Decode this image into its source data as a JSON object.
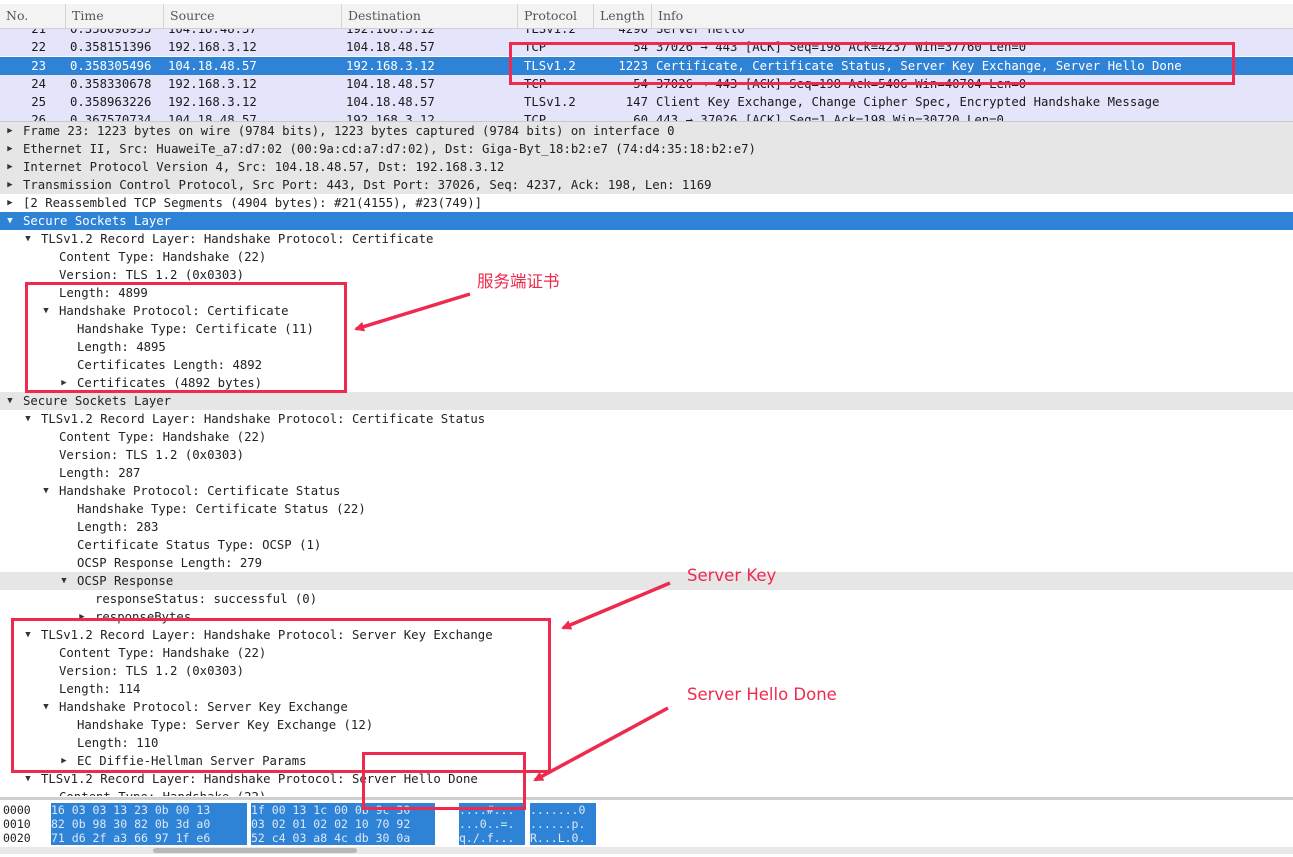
{
  "packet_list": {
    "columns": [
      "No.",
      "Time",
      "Source",
      "Destination",
      "Protocol",
      "Length",
      "Info"
    ],
    "rows": [
      {
        "no": "21",
        "time": "0.358098955",
        "src": "104.18.48.57",
        "dst": "192.168.3.12",
        "proto": "TLSv1.2",
        "len": "4290",
        "info": "Server Hello"
      },
      {
        "no": "22",
        "time": "0.358151396",
        "src": "192.168.3.12",
        "dst": "104.18.48.57",
        "proto": "TCP",
        "len": "54",
        "info": "37026 → 443 [ACK] Seq=198 Ack=4237 Win=37760 Len=0"
      },
      {
        "no": "23",
        "time": "0.358305496",
        "src": "104.18.48.57",
        "dst": "192.168.3.12",
        "proto": "TLSv1.2",
        "len": "1223",
        "info": "Certificate, Certificate Status, Server Key Exchange, Server Hello Done"
      },
      {
        "no": "24",
        "time": "0.358330678",
        "src": "192.168.3.12",
        "dst": "104.18.48.57",
        "proto": "TCP",
        "len": "54",
        "info": "37026 → 443 [ACK] Seq=198 Ack=5406 Win=40704 Len=0"
      },
      {
        "no": "25",
        "time": "0.358963226",
        "src": "192.168.3.12",
        "dst": "104.18.48.57",
        "proto": "TLSv1.2",
        "len": "147",
        "info": "Client Key Exchange, Change Cipher Spec, Encrypted Handshake Message"
      },
      {
        "no": "26",
        "time": "0.367570734",
        "src": "104.18.48.57",
        "dst": "192.168.3.12",
        "proto": "TCP",
        "len": "60",
        "info": "443 → 37026 [ACK] Seq=1 Ack=198 Win=30720 Len=0"
      }
    ]
  },
  "details": [
    {
      "indent": 0,
      "expander": "collapsed",
      "text": "Frame 23: 1223 bytes on wire (9784 bits), 1223 bytes captured (9784 bits) on interface 0",
      "style": "grey"
    },
    {
      "indent": 0,
      "expander": "collapsed",
      "text": "Ethernet II, Src: HuaweiTe_a7:d7:02 (00:9a:cd:a7:d7:02), Dst: Giga-Byt_18:b2:e7 (74:d4:35:18:b2:e7)",
      "style": "grey"
    },
    {
      "indent": 0,
      "expander": "collapsed",
      "text": "Internet Protocol Version 4, Src: 104.18.48.57, Dst: 192.168.3.12",
      "style": "grey"
    },
    {
      "indent": 0,
      "expander": "collapsed",
      "text": "Transmission Control Protocol, Src Port: 443, Dst Port: 37026, Seq: 4237, Ack: 198, Len: 1169",
      "style": "grey"
    },
    {
      "indent": 0,
      "expander": "collapsed",
      "text": "[2 Reassembled TCP Segments (4904 bytes): #21(4155), #23(749)]",
      "style": "white"
    },
    {
      "indent": 0,
      "expander": "expanded",
      "text": "Secure Sockets Layer",
      "style": "sel"
    },
    {
      "indent": 1,
      "expander": "expanded",
      "text": "TLSv1.2 Record Layer: Handshake Protocol: Certificate",
      "style": "white"
    },
    {
      "indent": 2,
      "expander": "none",
      "text": "Content Type: Handshake (22)",
      "style": "white"
    },
    {
      "indent": 2,
      "expander": "none",
      "text": "Version: TLS 1.2 (0x0303)",
      "style": "white"
    },
    {
      "indent": 2,
      "expander": "none",
      "text": "Length: 4899",
      "style": "white"
    },
    {
      "indent": 2,
      "expander": "expanded",
      "text": "Handshake Protocol: Certificate",
      "style": "white"
    },
    {
      "indent": 3,
      "expander": "none",
      "text": "Handshake Type: Certificate (11)",
      "style": "white"
    },
    {
      "indent": 3,
      "expander": "none",
      "text": "Length: 4895",
      "style": "white"
    },
    {
      "indent": 3,
      "expander": "none",
      "text": "Certificates Length: 4892",
      "style": "white"
    },
    {
      "indent": 3,
      "expander": "collapsed",
      "text": "Certificates (4892 bytes)",
      "style": "white"
    },
    {
      "indent": 0,
      "expander": "expanded",
      "text": "Secure Sockets Layer",
      "style": "grey"
    },
    {
      "indent": 1,
      "expander": "expanded",
      "text": "TLSv1.2 Record Layer: Handshake Protocol: Certificate Status",
      "style": "white"
    },
    {
      "indent": 2,
      "expander": "none",
      "text": "Content Type: Handshake (22)",
      "style": "white"
    },
    {
      "indent": 2,
      "expander": "none",
      "text": "Version: TLS 1.2 (0x0303)",
      "style": "white"
    },
    {
      "indent": 2,
      "expander": "none",
      "text": "Length: 287",
      "style": "white"
    },
    {
      "indent": 2,
      "expander": "expanded",
      "text": "Handshake Protocol: Certificate Status",
      "style": "white"
    },
    {
      "indent": 3,
      "expander": "none",
      "text": "Handshake Type: Certificate Status (22)",
      "style": "white"
    },
    {
      "indent": 3,
      "expander": "none",
      "text": "Length: 283",
      "style": "white"
    },
    {
      "indent": 3,
      "expander": "none",
      "text": "Certificate Status Type: OCSP (1)",
      "style": "white"
    },
    {
      "indent": 3,
      "expander": "none",
      "text": "OCSP Response Length: 279",
      "style": "white"
    },
    {
      "indent": 3,
      "expander": "expanded",
      "text": "OCSP Response",
      "style": "grey"
    },
    {
      "indent": 4,
      "expander": "none",
      "text": "responseStatus: successful (0)",
      "style": "white"
    },
    {
      "indent": 4,
      "expander": "collapsed",
      "text": "responseBytes",
      "style": "white"
    },
    {
      "indent": 1,
      "expander": "expanded",
      "text": "TLSv1.2 Record Layer: Handshake Protocol: Server Key Exchange",
      "style": "white"
    },
    {
      "indent": 2,
      "expander": "none",
      "text": "Content Type: Handshake (22)",
      "style": "white"
    },
    {
      "indent": 2,
      "expander": "none",
      "text": "Version: TLS 1.2 (0x0303)",
      "style": "white"
    },
    {
      "indent": 2,
      "expander": "none",
      "text": "Length: 114",
      "style": "white"
    },
    {
      "indent": 2,
      "expander": "expanded",
      "text": "Handshake Protocol: Server Key Exchange",
      "style": "white"
    },
    {
      "indent": 3,
      "expander": "none",
      "text": "Handshake Type: Server Key Exchange (12)",
      "style": "white"
    },
    {
      "indent": 3,
      "expander": "none",
      "text": "Length: 110",
      "style": "white"
    },
    {
      "indent": 3,
      "expander": "collapsed",
      "text": "EC Diffie-Hellman Server Params",
      "style": "white"
    },
    {
      "indent": 1,
      "expander": "expanded",
      "text": "TLSv1.2 Record Layer: Handshake Protocol: Server Hello Done",
      "style": "white"
    },
    {
      "indent": 2,
      "expander": "none",
      "text": "Content Type: Handshake (22)",
      "style": "white"
    }
  ],
  "bytes": [
    {
      "offset": "0000",
      "hex_a": "16 03 03 13 23 0b 00 13",
      "hex_b": "1f 00 13 1c 00 0b 9c 30",
      "ascii_a": "....#...",
      "ascii_b": ".......0"
    },
    {
      "offset": "0010",
      "hex_a": "82 0b 98 30 82 0b 3d a0",
      "hex_b": "03 02 01 02 02 10 70 92",
      "ascii_a": "...0..=.",
      "ascii_b": "......p."
    },
    {
      "offset": "0020",
      "hex_a": "71 d6 2f a3 66 97 1f e6",
      "hex_b": "52 c4 03 a8 4c db 30 0a",
      "ascii_a": "q./.f...",
      "ascii_b": "R...L.0."
    }
  ],
  "annotations": {
    "certificate_label": "服务端证书",
    "server_key_label": "Server Key",
    "server_hello_done_label": "Server Hello Done",
    "color": "#ee2a4e"
  },
  "colors": {
    "selection": "#2e83d6",
    "tls_row": "#e4e4fb",
    "grey_row": "#e6e6e6"
  }
}
